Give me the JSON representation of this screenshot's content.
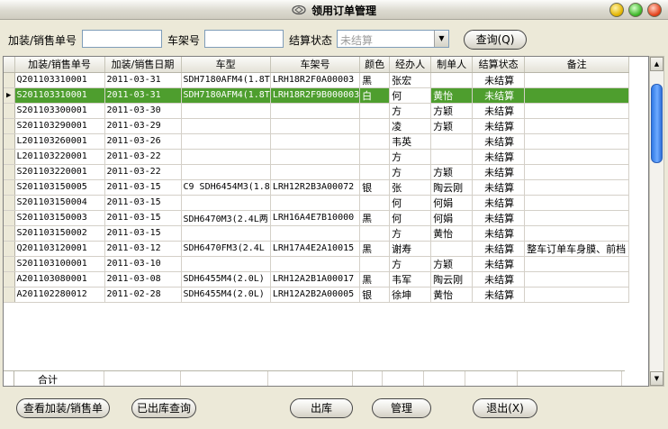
{
  "window": {
    "title": "领用订单管理"
  },
  "filters": {
    "order_no_label": "加装/销售单号",
    "order_no_value": "",
    "frame_no_label": "车架号",
    "frame_no_value": "",
    "status_label": "结算状态",
    "status_value": "未结算",
    "query_button": "查询(Q)"
  },
  "table": {
    "columns": [
      "加装/销售单号",
      "加装/销售日期",
      "车型",
      "车架号",
      "颜色",
      "经办人",
      "制单人",
      "结算状态",
      "备注"
    ],
    "rows": [
      [
        "Q201103310001",
        "2011-03-31",
        "SDH7180AFM4(1.8T",
        "LRH18R2F0A00003",
        "黑",
        "张宏",
        "",
        "未结算",
        ""
      ],
      [
        "S201103310001",
        "2011-03-31",
        "SDH7180AFM4(1.8T",
        "LRH18R2F9B000003",
        "白",
        "何",
        "黄怡",
        "未结算",
        ""
      ],
      [
        "S201103300001",
        "2011-03-30",
        "",
        "",
        "",
        "方",
        "方颖",
        "未结算",
        ""
      ],
      [
        "S201103290001",
        "2011-03-29",
        "",
        "",
        "",
        "凌",
        "方颖",
        "未结算",
        ""
      ],
      [
        "L201103260001",
        "2011-03-26",
        "",
        "",
        "",
        "韦英",
        "",
        "未结算",
        ""
      ],
      [
        "L201103220001",
        "2011-03-22",
        "",
        "",
        "",
        "方",
        "",
        "未结算",
        ""
      ],
      [
        "S201103220001",
        "2011-03-22",
        "",
        "",
        "",
        "方",
        "方颖",
        "未结算",
        ""
      ],
      [
        "S201103150005",
        "2011-03-15",
        "C9 SDH6454M3(1.8",
        "LRH12R2B3A00072",
        "银",
        "张",
        "陶云刚",
        "未结算",
        ""
      ],
      [
        "S201103150004",
        "2011-03-15",
        "",
        "",
        "",
        "何",
        "何娟",
        "未结算",
        ""
      ],
      [
        "S201103150003",
        "2011-03-15",
        "SDH6470M3(2.4L两",
        "LRH16A4E7B10000",
        "黑",
        "何",
        "何娟",
        "未结算",
        ""
      ],
      [
        "S201103150002",
        "2011-03-15",
        "",
        "",
        "",
        "方",
        "黄怡",
        "未结算",
        ""
      ],
      [
        "Q201103120001",
        "2011-03-12",
        "SDH6470FM3(2.4L",
        "LRH17A4E2A10015",
        "黑",
        "谢寿",
        "",
        "未结算",
        "整车订单车身膜、前档"
      ],
      [
        "S201103100001",
        "2011-03-10",
        "",
        "",
        "",
        "方",
        "方颖",
        "未结算",
        ""
      ],
      [
        "A201103080001",
        "2011-03-08",
        "SDH6455M4(2.0L)",
        "LRH12A2B1A00017",
        "黑",
        "韦军",
        "陶云刚",
        "未结算",
        ""
      ],
      [
        "A201102280012",
        "2011-02-28",
        "SDH6455M4(2.0L)",
        "LRH12A2B2A00005",
        "银",
        "徐坤",
        "黄怡",
        "未结算",
        ""
      ]
    ],
    "selected_row_index": 1,
    "total_label": "合计"
  },
  "buttons": {
    "view": "查看加装/销售单",
    "stocked_query": "已出库查询",
    "out": "出库",
    "manage": "管理",
    "exit": "退出(X)"
  },
  "scroll": {
    "position_fraction": 0.0
  }
}
